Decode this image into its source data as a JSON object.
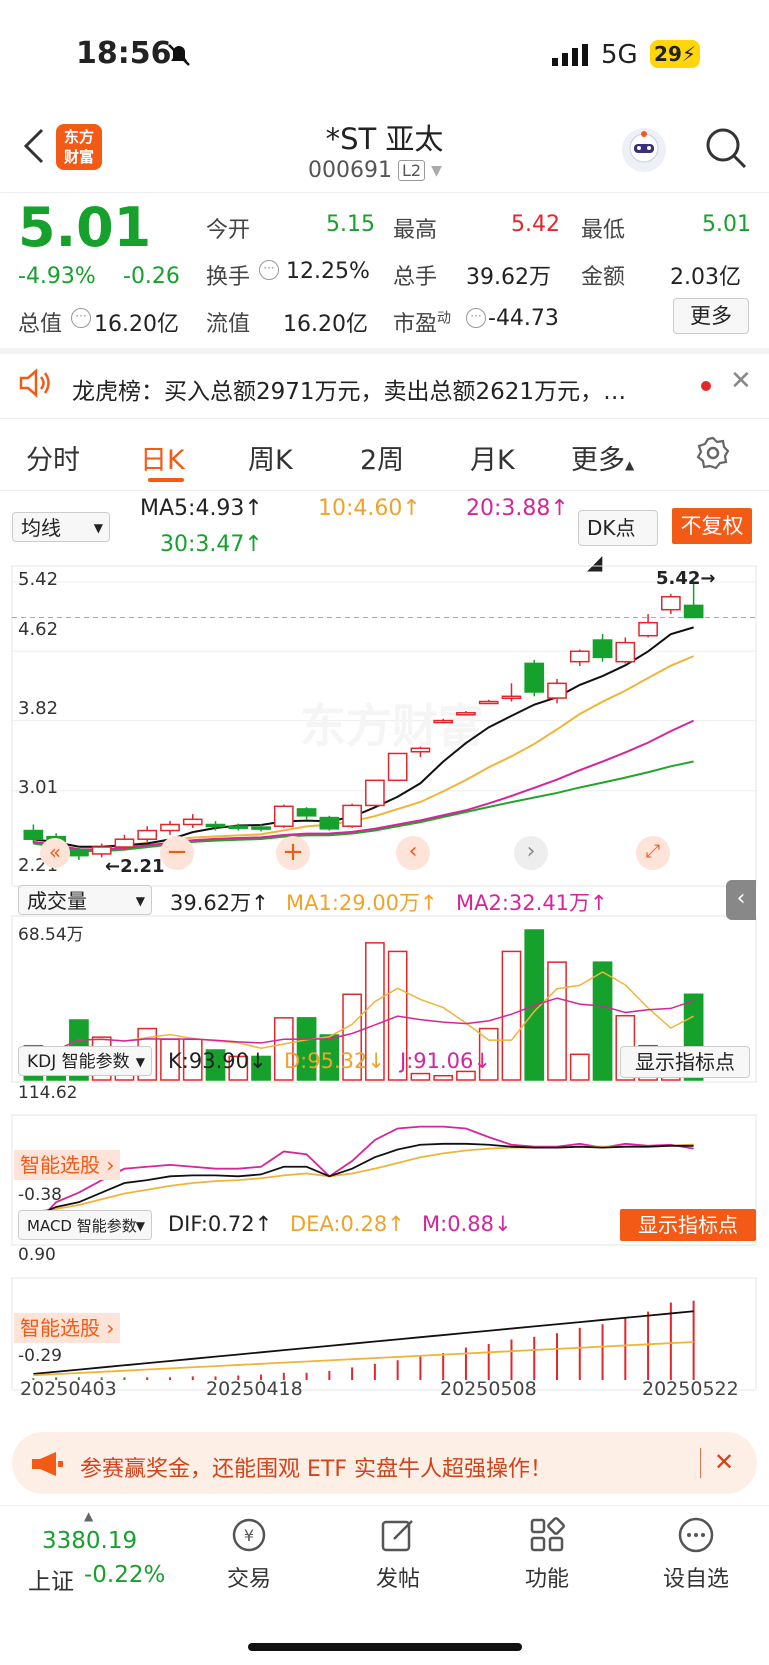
{
  "status": {
    "time": "18:56",
    "network": "5G",
    "battery": "29"
  },
  "header": {
    "logo_line1": "东方",
    "logo_line2": "财富",
    "title": "*ST 亚太",
    "code": "000691",
    "level": "L2"
  },
  "quote": {
    "price": "5.01",
    "pct": "-4.93%",
    "chg": "-0.26",
    "open_label": "今开",
    "open": "5.15",
    "high_label": "最高",
    "high": "5.42",
    "low_label": "最低",
    "low": "5.01",
    "turnover_label": "换手",
    "turnover": "12.25%",
    "vol_label": "总手",
    "vol": "39.62万",
    "amt_label": "金额",
    "amt": "2.03亿",
    "mcap_label": "总值",
    "mcap": "16.20亿",
    "float_label": "流值",
    "float": "16.20亿",
    "pe_label": "市盈",
    "pe_sup": "动",
    "pe": "-44.73",
    "more": "更多"
  },
  "notice": {
    "text": "龙虎榜：买入总额2971万元，卖出总额2621万元，…"
  },
  "tabs": [
    "分时",
    "日K",
    "周K",
    "2周",
    "月K",
    "更多"
  ],
  "ma_bar": {
    "select": "均线",
    "ma5": "MA5:4.93↑",
    "ma10": "10:4.60↑",
    "ma20": "20:3.88↑",
    "ma30": "30:3.47↑",
    "dk": "DK点",
    "fq": "不复权"
  },
  "kline": {
    "axis": [
      "5.42",
      "4.62",
      "3.82",
      "3.01",
      "2.21"
    ],
    "high_mark": "5.42→",
    "low_mark": "←2.21",
    "watermark": "东方财富"
  },
  "volume": {
    "select": "成交量",
    "val": "39.62万↑",
    "ma1": "MA1:29.00万↑",
    "ma2": "MA2:32.41万↑",
    "axis_top": "68.54万"
  },
  "kdj": {
    "select": "KDJ 智能参数",
    "k": "K:93.90↓",
    "d": "D:95.32↓",
    "j": "J:91.06↓",
    "btn": "显示指标点",
    "axis_top": "114.62",
    "axis_bot": "-0.38",
    "smart": "智能选股 ›"
  },
  "macd": {
    "select": "MACD 智能参数",
    "dif": "DIF:0.72↑",
    "dea": "DEA:0.28↑",
    "m": "M:0.88↓",
    "btn": "显示指标点",
    "axis_top": "0.90",
    "axis_bot": "-0.29",
    "smart": "智能选股 ›"
  },
  "dates": [
    "20250403",
    "20250418",
    "20250508",
    "20250522"
  ],
  "ad": {
    "text": "参赛赢奖金，还能围观 ETF 实盘牛人超强操作！"
  },
  "bottom": {
    "index_val": "3380.19",
    "index_name": "上证",
    "index_pct": "-0.22%",
    "trade": "交易",
    "post": "发帖",
    "func": "功能",
    "watch": "设自选"
  },
  "colors": {
    "up": "#e3262a",
    "down": "#16a02c",
    "accent": "#f25a16",
    "ma10": "#f0b43a",
    "ma20": "#d5259a",
    "ma30": "#22a52e"
  },
  "chart_data": {
    "type": "candlestick",
    "candles": [
      {
        "o": 2.55,
        "c": 2.45,
        "h": 2.62,
        "l": 2.4
      },
      {
        "o": 2.48,
        "c": 2.38,
        "h": 2.52,
        "l": 2.3
      },
      {
        "o": 2.33,
        "c": 2.26,
        "h": 2.36,
        "l": 2.21
      },
      {
        "o": 2.28,
        "c": 2.36,
        "h": 2.4,
        "l": 2.24
      },
      {
        "o": 2.36,
        "c": 2.45,
        "h": 2.5,
        "l": 2.32
      },
      {
        "o": 2.45,
        "c": 2.55,
        "h": 2.6,
        "l": 2.42
      },
      {
        "o": 2.55,
        "c": 2.62,
        "h": 2.66,
        "l": 2.5
      },
      {
        "o": 2.62,
        "c": 2.68,
        "h": 2.74,
        "l": 2.58
      },
      {
        "o": 2.62,
        "c": 2.6,
        "h": 2.66,
        "l": 2.55
      },
      {
        "o": 2.6,
        "c": 2.59,
        "h": 2.63,
        "l": 2.55
      },
      {
        "o": 2.59,
        "c": 2.58,
        "h": 2.62,
        "l": 2.54
      },
      {
        "o": 2.6,
        "c": 2.83,
        "h": 2.85,
        "l": 2.58
      },
      {
        "o": 2.8,
        "c": 2.72,
        "h": 2.82,
        "l": 2.68
      },
      {
        "o": 2.7,
        "c": 2.57,
        "h": 2.72,
        "l": 2.55
      },
      {
        "o": 2.6,
        "c": 2.84,
        "h": 2.86,
        "l": 2.58
      },
      {
        "o": 2.84,
        "c": 3.13,
        "h": 3.13,
        "l": 2.84
      },
      {
        "o": 3.13,
        "c": 3.44,
        "h": 3.44,
        "l": 3.13
      },
      {
        "o": 3.46,
        "c": 3.5,
        "h": 3.52,
        "l": 3.4
      },
      {
        "o": 3.8,
        "c": 3.82,
        "h": 3.84,
        "l": 3.8
      },
      {
        "o": 3.9,
        "c": 3.91,
        "h": 3.93,
        "l": 3.9
      },
      {
        "o": 4.03,
        "c": 4.04,
        "h": 4.06,
        "l": 4.03
      },
      {
        "o": 4.08,
        "c": 4.1,
        "h": 4.25,
        "l": 4.04
      },
      {
        "o": 4.48,
        "c": 4.15,
        "h": 4.52,
        "l": 4.1
      },
      {
        "o": 4.08,
        "c": 4.25,
        "h": 4.3,
        "l": 4.02
      },
      {
        "o": 4.5,
        "c": 4.62,
        "h": 4.64,
        "l": 4.45
      },
      {
        "o": 4.75,
        "c": 4.55,
        "h": 4.82,
        "l": 4.5
      },
      {
        "o": 4.5,
        "c": 4.72,
        "h": 4.78,
        "l": 4.48
      },
      {
        "o": 4.8,
        "c": 4.95,
        "h": 5.05,
        "l": 4.78
      },
      {
        "o": 5.1,
        "c": 5.25,
        "h": 5.28,
        "l": 5.05
      },
      {
        "o": 5.15,
        "c": 5.01,
        "h": 5.42,
        "l": 5.01
      }
    ],
    "ma5_last": 4.93,
    "ma10_last": 4.6,
    "ma20_last": 3.88,
    "ma30_last": 3.47,
    "ylim": [
      2.21,
      5.42
    ],
    "volume": [
      16,
      12,
      28,
      20,
      15,
      24,
      19,
      19,
      14,
      11,
      11,
      29,
      29,
      21,
      40,
      64,
      60,
      3,
      2,
      4,
      24,
      60,
      70,
      55,
      12,
      55,
      30,
      16,
      8,
      40
    ],
    "volume_up": [
      false,
      false,
      false,
      true,
      true,
      true,
      true,
      true,
      false,
      true,
      false,
      true,
      false,
      false,
      true,
      true,
      true,
      true,
      true,
      true,
      true,
      true,
      false,
      true,
      true,
      false,
      true,
      true,
      true,
      false
    ],
    "dates": [
      "20250403",
      "20250418",
      "20250508",
      "20250522"
    ]
  }
}
